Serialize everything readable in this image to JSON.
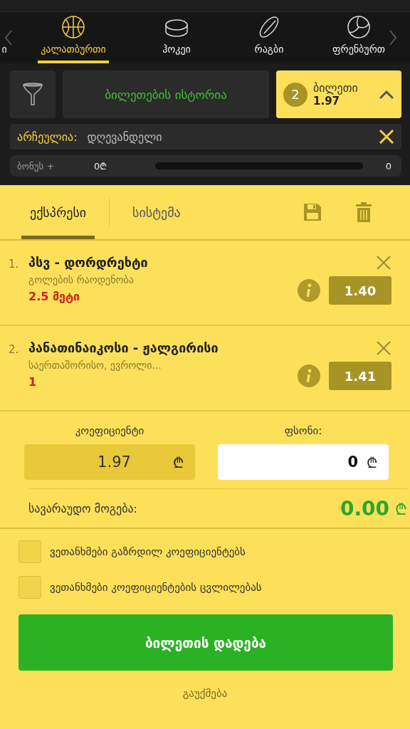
{
  "sports": [
    {
      "label": "ი",
      "kind": "none",
      "selected": false
    },
    {
      "label": "კალათბურთი",
      "kind": "basketball",
      "selected": true
    },
    {
      "label": "ჰოკეი",
      "kind": "hockey",
      "selected": false
    },
    {
      "label": "რაგბი",
      "kind": "rugby",
      "selected": false
    },
    {
      "label": "ფრენბურთ",
      "kind": "volleyball",
      "selected": false
    }
  ],
  "history_button": "ბილეთების ისტორია",
  "ticket": {
    "count": "2",
    "label": "ბილეთი",
    "odds": "1.97",
    "expanded": true
  },
  "filter": {
    "label": "არჩეულია:",
    "value": "დღევანდელი"
  },
  "bonus": {
    "label": "ბონუს +",
    "amount": "0₾",
    "level": 0,
    "count": "0"
  },
  "bet_tabs": [
    {
      "label": "ექსპრესი",
      "selected": true
    },
    {
      "label": "სისტემა",
      "selected": false
    }
  ],
  "bets": [
    {
      "number": "1.",
      "match": "პსვ - დორდრეხტი",
      "market": "გოლების რაოდენობა",
      "pick": "2.5 მეტი",
      "odds": "1.40"
    },
    {
      "number": "2.",
      "match": "პანათინაიკოსი - ჟალგირისი",
      "market": "საერთაშორისო, ევროლი...",
      "pick": "1",
      "odds": "1.41"
    }
  ],
  "coefficient": {
    "label": "კოეფიციენტი",
    "value": "1.97",
    "currency": "₾"
  },
  "stake": {
    "label": "ფსონი:",
    "value": "0",
    "currency": "₾"
  },
  "winnings": {
    "label": "სავარაუდო მოგება:",
    "value": "0.00",
    "currency": "₾"
  },
  "agreements": [
    {
      "label": "ვეთანხმები გაზრდილ კოეფიციენტებს",
      "checked": false
    },
    {
      "label": "ვეთანხმები კოეფიციენტების ცვლილებას",
      "checked": false
    }
  ],
  "submit_button": "ბილეთის დადება",
  "cancel_link": "გაუქმება"
}
